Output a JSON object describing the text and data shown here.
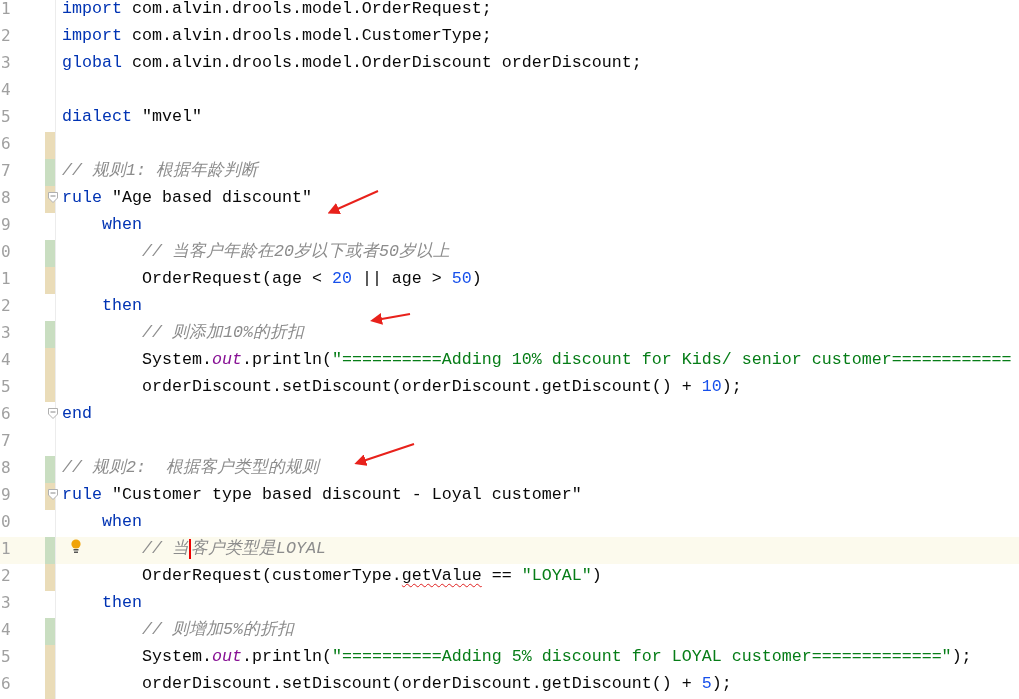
{
  "editor": {
    "lines": [
      {
        "number": "1",
        "added": false,
        "modified": false,
        "fold": false,
        "current": false,
        "hint": false,
        "tokens": [
          {
            "kind": "kw",
            "text": "import"
          },
          {
            "kind": "plain",
            "text": " com.alvin.drools.model.OrderRequest;"
          }
        ]
      },
      {
        "number": "2",
        "added": false,
        "modified": false,
        "fold": false,
        "current": false,
        "hint": false,
        "tokens": [
          {
            "kind": "kw",
            "text": "import"
          },
          {
            "kind": "plain",
            "text": " com.alvin.drools.model.CustomerType;"
          }
        ]
      },
      {
        "number": "3",
        "added": false,
        "modified": false,
        "fold": false,
        "current": false,
        "hint": false,
        "tokens": [
          {
            "kind": "kw",
            "text": "global"
          },
          {
            "kind": "plain",
            "text": " com.alvin.drools.model.OrderDiscount orderDiscount;"
          }
        ]
      },
      {
        "number": "4",
        "added": false,
        "modified": false,
        "fold": false,
        "current": false,
        "hint": false
      },
      {
        "number": "5",
        "added": false,
        "modified": false,
        "fold": false,
        "current": false,
        "hint": false,
        "tokens": [
          {
            "kind": "kw",
            "text": "dialect"
          },
          {
            "kind": "plain",
            "text": " \"mvel\""
          }
        ]
      },
      {
        "number": "6",
        "added": false,
        "modified": true,
        "fold": false,
        "current": false,
        "hint": false
      },
      {
        "number": "7",
        "added": true,
        "modified": false,
        "fold": false,
        "current": false,
        "hint": false,
        "tokens": [
          {
            "kind": "comment",
            "text": "// 规则1: 根据年龄判断"
          }
        ]
      },
      {
        "number": "8",
        "added": false,
        "modified": true,
        "fold": true,
        "current": false,
        "hint": false,
        "tokens": [
          {
            "kind": "kw",
            "text": "rule"
          },
          {
            "kind": "plain",
            "text": " \"Age based discount\""
          }
        ]
      },
      {
        "number": "9",
        "added": false,
        "modified": false,
        "fold": false,
        "current": false,
        "hint": false,
        "tokens": [
          {
            "kind": "kw",
            "text": "    when"
          }
        ]
      },
      {
        "number": "0",
        "added": true,
        "modified": false,
        "fold": false,
        "current": false,
        "hint": false,
        "tokens": [
          {
            "kind": "comment",
            "text": "        // 当客户年龄在20岁以下或者50岁以上"
          }
        ]
      },
      {
        "number": "1",
        "added": false,
        "modified": true,
        "fold": false,
        "current": false,
        "hint": false,
        "tokens": [
          {
            "kind": "plain",
            "text": "        OrderRequest(age < "
          },
          {
            "kind": "number",
            "text": "20"
          },
          {
            "kind": "plain",
            "text": " || age > "
          },
          {
            "kind": "number",
            "text": "50"
          },
          {
            "kind": "plain",
            "text": ")"
          }
        ]
      },
      {
        "number": "2",
        "added": false,
        "modified": false,
        "fold": false,
        "current": false,
        "hint": false,
        "tokens": [
          {
            "kind": "kw",
            "text": "    then"
          }
        ]
      },
      {
        "number": "3",
        "added": true,
        "modified": false,
        "fold": false,
        "current": false,
        "hint": false,
        "tokens": [
          {
            "kind": "comment",
            "text": "        // 则添加10%的折扣"
          }
        ]
      },
      {
        "number": "4",
        "added": false,
        "modified": true,
        "fold": false,
        "current": false,
        "hint": false,
        "tokens": [
          {
            "kind": "plain",
            "text": "        System."
          },
          {
            "kind": "field",
            "text": "out"
          },
          {
            "kind": "plain",
            "text": ".println("
          },
          {
            "kind": "string",
            "text": "\"==========Adding 10% discount for Kids/ senior customer============"
          }
        ]
      },
      {
        "number": "5",
        "added": false,
        "modified": true,
        "fold": false,
        "current": false,
        "hint": false,
        "tokens": [
          {
            "kind": "plain",
            "text": "        orderDiscount.setDiscount(orderDiscount.getDiscount() + "
          },
          {
            "kind": "number",
            "text": "10"
          },
          {
            "kind": "plain",
            "text": ");"
          }
        ]
      },
      {
        "number": "6",
        "added": false,
        "modified": false,
        "fold": true,
        "current": false,
        "hint": false,
        "tokens": [
          {
            "kind": "kw",
            "text": "end"
          }
        ]
      },
      {
        "number": "7",
        "added": false,
        "modified": false,
        "fold": false,
        "current": false,
        "hint": false
      },
      {
        "number": "8",
        "added": true,
        "modified": false,
        "fold": false,
        "current": false,
        "hint": false,
        "tokens": [
          {
            "kind": "comment",
            "text": "// 规则2:  根据客户类型的规则"
          }
        ]
      },
      {
        "number": "9",
        "added": false,
        "modified": true,
        "fold": true,
        "current": false,
        "hint": false,
        "tokens": [
          {
            "kind": "kw",
            "text": "rule"
          },
          {
            "kind": "plain",
            "text": " \"Customer type based discount - Loyal customer\""
          }
        ]
      },
      {
        "number": "0",
        "added": false,
        "modified": false,
        "fold": false,
        "current": false,
        "hint": false,
        "tokens": [
          {
            "kind": "kw",
            "text": "    when"
          }
        ]
      },
      {
        "number": "1",
        "added": true,
        "modified": false,
        "fold": false,
        "current": true,
        "hint": true,
        "tokens": [
          {
            "kind": "comment",
            "text": "        // 当"
          },
          {
            "kind": "caret"
          },
          {
            "kind": "comment",
            "text": "客户类型是LOYAL"
          }
        ]
      },
      {
        "number": "2",
        "added": false,
        "modified": true,
        "fold": false,
        "current": false,
        "hint": false,
        "tokens": [
          {
            "kind": "plain",
            "text": "        OrderRequest(customerType."
          },
          {
            "kind": "warning",
            "text": "getValue"
          },
          {
            "kind": "plain",
            "text": " == "
          },
          {
            "kind": "string",
            "text": "\"LOYAL\""
          },
          {
            "kind": "plain",
            "text": ")"
          }
        ]
      },
      {
        "number": "3",
        "added": false,
        "modified": false,
        "fold": false,
        "current": false,
        "hint": false,
        "tokens": [
          {
            "kind": "kw",
            "text": "    then"
          }
        ]
      },
      {
        "number": "4",
        "added": true,
        "modified": false,
        "fold": false,
        "current": false,
        "hint": false,
        "tokens": [
          {
            "kind": "comment",
            "text": "        // 则增加5%的折扣"
          }
        ]
      },
      {
        "number": "5",
        "added": false,
        "modified": true,
        "fold": false,
        "current": false,
        "hint": false,
        "tokens": [
          {
            "kind": "plain",
            "text": "        System."
          },
          {
            "kind": "field",
            "text": "out"
          },
          {
            "kind": "plain",
            "text": ".println("
          },
          {
            "kind": "string",
            "text": "\"==========Adding 5% discount for LOYAL customer=============\""
          },
          {
            "kind": "plain",
            "text": ");"
          }
        ]
      },
      {
        "number": "6",
        "added": false,
        "modified": true,
        "fold": false,
        "current": false,
        "hint": false,
        "tokens": [
          {
            "kind": "plain",
            "text": "        orderDiscount.setDiscount(orderDiscount.getDiscount() + "
          },
          {
            "kind": "number",
            "text": "5"
          },
          {
            "kind": "plain",
            "text": ");"
          }
        ]
      }
    ]
  }
}
